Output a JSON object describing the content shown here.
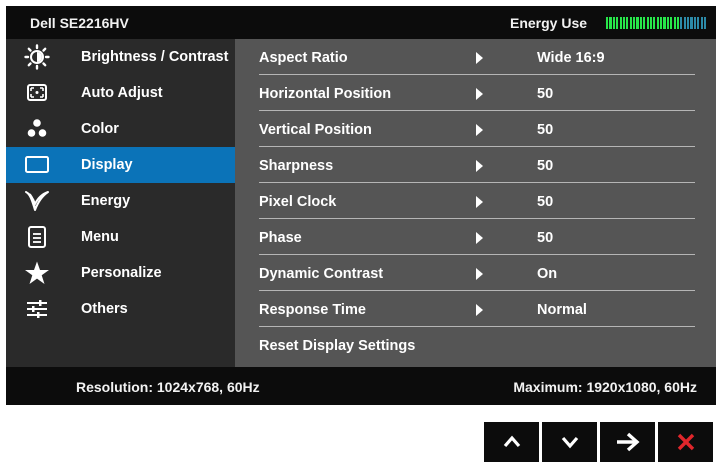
{
  "header": {
    "model": "Dell SE2216HV",
    "energy_label": "Energy Use",
    "energy_level": 0.72
  },
  "sidebar": {
    "items": [
      {
        "label": "Brightness / Contrast",
        "icon": "brightness-icon",
        "active": false
      },
      {
        "label": "Auto Adjust",
        "icon": "auto-adjust-icon",
        "active": false
      },
      {
        "label": "Color",
        "icon": "color-dots-icon",
        "active": false
      },
      {
        "label": "Display",
        "icon": "display-icon",
        "active": true
      },
      {
        "label": "Energy",
        "icon": "energy-leaf-icon",
        "active": false
      },
      {
        "label": "Menu",
        "icon": "menu-icon",
        "active": false
      },
      {
        "label": "Personalize",
        "icon": "star-icon",
        "active": false
      },
      {
        "label": "Others",
        "icon": "sliders-icon",
        "active": false
      }
    ]
  },
  "settings": {
    "rows": [
      {
        "label": "Aspect Ratio",
        "value": "Wide 16:9"
      },
      {
        "label": "Horizontal Position",
        "value": "50"
      },
      {
        "label": "Vertical Position",
        "value": "50"
      },
      {
        "label": "Sharpness",
        "value": "50"
      },
      {
        "label": "Pixel Clock",
        "value": "50"
      },
      {
        "label": "Phase",
        "value": "50"
      },
      {
        "label": "Dynamic Contrast",
        "value": "On"
      },
      {
        "label": "Response Time",
        "value": "Normal"
      }
    ],
    "reset_label": "Reset Display Settings"
  },
  "footer": {
    "resolution": "Resolution: 1024x768, 60Hz",
    "maximum": "Maximum: 1920x1080, 60Hz"
  },
  "hardware_buttons": [
    {
      "icon": "up-chevron-icon"
    },
    {
      "icon": "down-chevron-icon"
    },
    {
      "icon": "right-arrow-icon"
    },
    {
      "icon": "close-x-icon"
    }
  ],
  "colors": {
    "active_blue": "#0b73b8",
    "energy_green": "#27e64a",
    "energy_off": "#2c8aa8",
    "close_red": "#e0262b"
  }
}
